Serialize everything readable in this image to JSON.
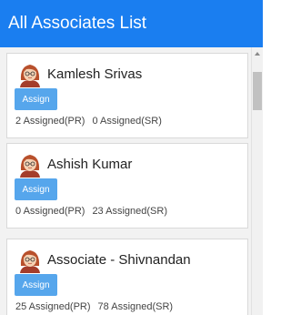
{
  "header": {
    "title": "All Associates List"
  },
  "associates": [
    {
      "name": "Kamlesh Srivas",
      "assign_label": "Assign",
      "pr": "2 Assigned(PR)",
      "sr": "0 Assigned(SR)",
      "avatar_icon": "female-avatar-icon"
    },
    {
      "name": "Ashish Kumar",
      "assign_label": "Assign",
      "pr": "0 Assigned(PR)",
      "sr": "23 Assigned(SR)",
      "avatar_icon": "female-avatar-icon"
    },
    {
      "name": "Associate - Shivnandan",
      "assign_label": "Assign",
      "pr": "25 Assigned(PR)",
      "sr": "78 Assigned(SR)",
      "avatar_icon": "female-avatar-icon"
    }
  ],
  "colors": {
    "header": "#1a7ef0",
    "button": "#56a6ec",
    "background": "#f2f2f2"
  }
}
